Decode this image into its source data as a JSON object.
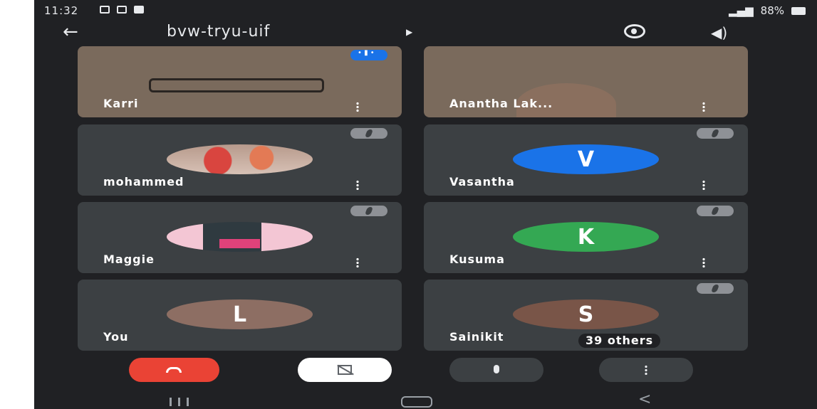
{
  "status_bar": {
    "time": "11:32",
    "battery": "88%"
  },
  "meeting": {
    "code": "bvw-tryu-uif"
  },
  "participants": [
    {
      "name": "Karri"
    },
    {
      "name": "Anantha Lak..."
    },
    {
      "name": "mohammed"
    },
    {
      "name": "Vasantha",
      "initial": "V",
      "color": "#1a73e8"
    },
    {
      "name": "Maggie"
    },
    {
      "name": "Kusuma",
      "initial": "K",
      "color": "#34a853"
    },
    {
      "name": "You",
      "initial": "L",
      "color": "#8d6e63"
    },
    {
      "name": "Sainikit",
      "initial": "S",
      "color": "#795548"
    }
  ],
  "overflow": {
    "label": "39 others"
  },
  "colors": {
    "background": "#202124",
    "tile": "#3c4043",
    "end_call": "#ea4335",
    "pin": "#1a73e8"
  }
}
